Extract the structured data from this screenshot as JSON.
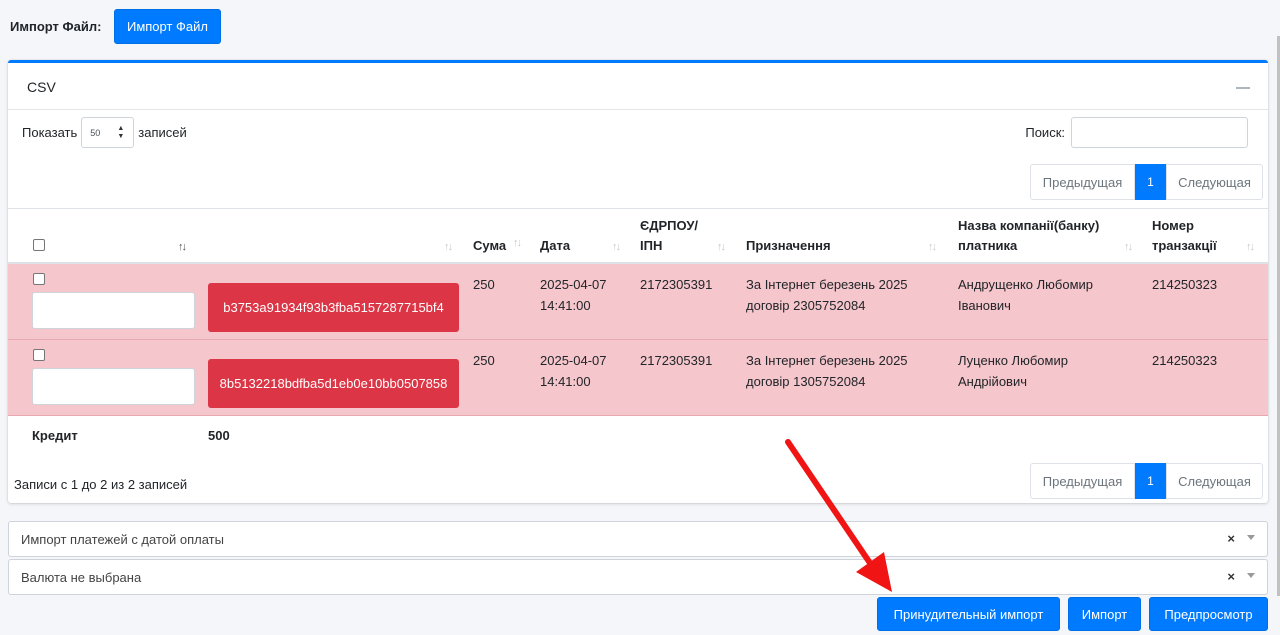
{
  "top": {
    "import_label": "Импорт Файл:",
    "import_button": "Импорт Файл"
  },
  "card": {
    "title": "CSV",
    "show_label": "Показать",
    "show_value": "50",
    "entries_label": "записей",
    "search_label": "Поиск:",
    "search_value": ""
  },
  "pagination": {
    "prev": "Предыдущая",
    "current": "1",
    "next": "Следующая"
  },
  "table": {
    "headers": {
      "sum": "Сума",
      "date": "Дата",
      "edrpou": "ЄДРПОУ/ ІПН",
      "purpose": "Призначення",
      "company": "Назва компанії(банку) платника",
      "transaction": "Номер транзакції"
    },
    "rows": [
      {
        "input_value": "",
        "hash": "b3753a91934f93b3fba5157287715bf4",
        "sum": "250",
        "date": "2025-04-07 14:41:00",
        "edrpou": "2172305391",
        "purpose": "За Інтернет березень 2025 договір 2305752084",
        "company": "Андрущенко Любомир Іванович",
        "transaction": "214250323"
      },
      {
        "input_value": "",
        "hash": "8b5132218bdfba5d1eb0e10bb0507858",
        "sum": "250",
        "date": "2025-04-07 14:41:00",
        "edrpou": "2172305391",
        "purpose": "За Інтернет березень 2025 договір 1305752084",
        "company": "Луценко Любомир Андрійович",
        "transaction": "214250323"
      }
    ],
    "footer": {
      "label": "Кредит",
      "total": "500"
    }
  },
  "info": "Записи с 1 до 2 из 2 записей",
  "selects": {
    "import_mode": "Импорт платежей с датой оплаты",
    "currency": "Валюта не выбрана",
    "clear_symbol": "×"
  },
  "buttons": {
    "force_import": "Принудительный импорт",
    "import": "Импорт",
    "preview": "Предпросмотр"
  },
  "colors": {
    "primary": "#007bff",
    "danger": "#dc3545",
    "row_highlight": "#f5c6cb",
    "annotation_arrow": "#f01414"
  },
  "icons": {
    "collapse": "minus-icon",
    "sort": "sort-arrows-icon",
    "select_caret": "caret-down-icon",
    "clear": "clear-x-icon",
    "annotation": "red-arrow-annotation"
  }
}
